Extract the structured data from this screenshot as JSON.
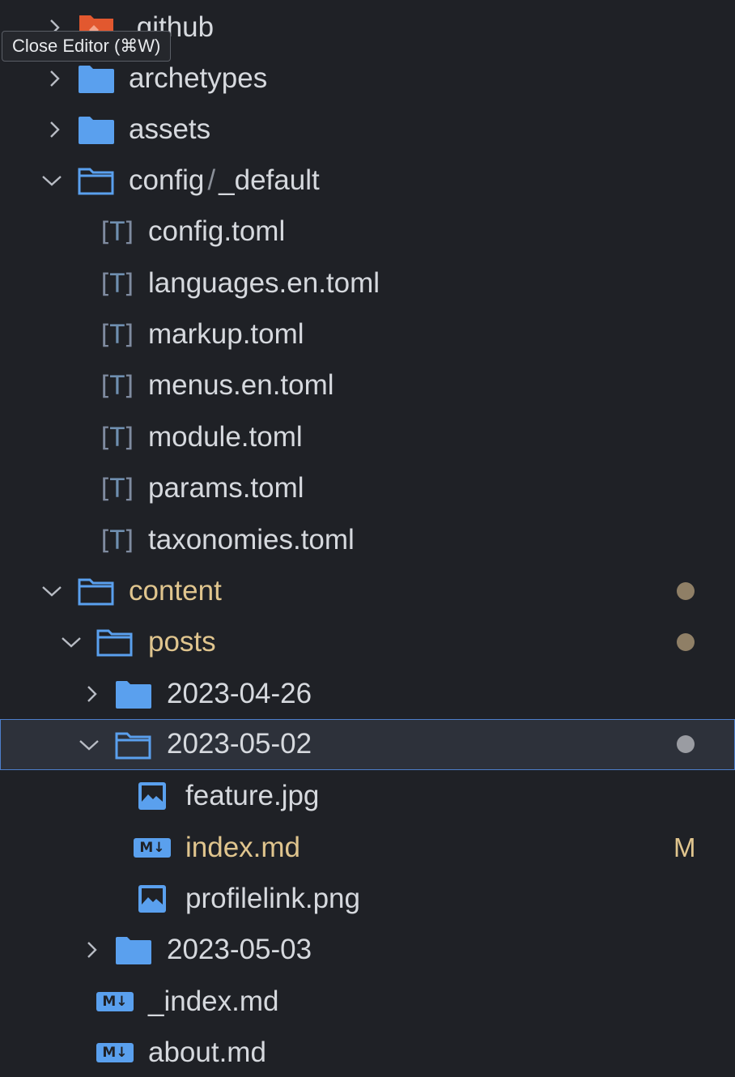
{
  "tooltip": {
    "text": "Close Editor (⌘W)"
  },
  "colors": {
    "folder": "#5aa0ee",
    "modified_text": "#e0c58e",
    "dot_brown": "#8f7f66",
    "dot_gray": "#9a9ca2",
    "selection_border": "#4d7ecb",
    "git_folder": "#e2582f"
  },
  "tree": [
    {
      "label": ".github",
      "kind": "folder",
      "icon": "git-folder-icon",
      "expanded": false
    },
    {
      "label": "archetypes",
      "kind": "folder",
      "icon": "folder-icon",
      "expanded": false
    },
    {
      "label": "assets",
      "kind": "folder",
      "icon": "folder-icon",
      "expanded": false
    },
    {
      "label": "config",
      "label_suffix": "_default",
      "separator": "/",
      "kind": "folder",
      "icon": "folder-open-icon",
      "expanded": true
    },
    {
      "label": "config.toml",
      "kind": "file",
      "icon": "toml-file-icon"
    },
    {
      "label": "languages.en.toml",
      "kind": "file",
      "icon": "toml-file-icon"
    },
    {
      "label": "markup.toml",
      "kind": "file",
      "icon": "toml-file-icon"
    },
    {
      "label": "menus.en.toml",
      "kind": "file",
      "icon": "toml-file-icon"
    },
    {
      "label": "module.toml",
      "kind": "file",
      "icon": "toml-file-icon"
    },
    {
      "label": "params.toml",
      "kind": "file",
      "icon": "toml-file-icon"
    },
    {
      "label": "taxonomies.toml",
      "kind": "file",
      "icon": "toml-file-icon"
    },
    {
      "label": "content",
      "kind": "folder",
      "icon": "folder-open-icon",
      "expanded": true,
      "status": "dot"
    },
    {
      "label": "posts",
      "kind": "folder",
      "icon": "folder-open-icon",
      "expanded": true,
      "status": "dot"
    },
    {
      "label": "2023-04-26",
      "kind": "folder",
      "icon": "folder-icon",
      "expanded": false
    },
    {
      "label": "2023-05-02",
      "kind": "folder",
      "icon": "folder-open-icon",
      "expanded": true,
      "status": "dot",
      "selected": true
    },
    {
      "label": "feature.jpg",
      "kind": "file",
      "icon": "image-file-icon"
    },
    {
      "label": "index.md",
      "kind": "file",
      "icon": "markdown-file-icon",
      "status": "M"
    },
    {
      "label": "profilelink.png",
      "kind": "file",
      "icon": "image-file-icon"
    },
    {
      "label": "2023-05-03",
      "kind": "folder",
      "icon": "folder-icon",
      "expanded": false
    },
    {
      "label": "_index.md",
      "kind": "file",
      "icon": "markdown-file-icon"
    },
    {
      "label": "about.md",
      "kind": "file",
      "icon": "markdown-file-icon"
    }
  ]
}
